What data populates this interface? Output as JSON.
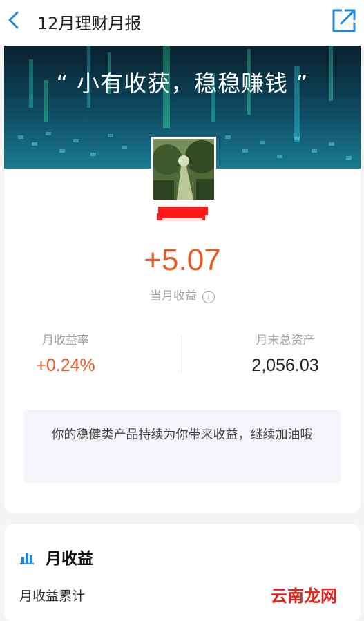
{
  "header": {
    "title": "12月理财月报"
  },
  "banner": {
    "quote": "“ 小有收获，稳稳赚钱 ”"
  },
  "summary": {
    "amount": "+5.07",
    "amount_label": "当月收益",
    "rate_label": "月收益率",
    "rate_value": "+0.24%",
    "assets_label": "月末总资产",
    "assets_value": "2,056.03",
    "tip": "你的稳健类产品持续为你带来收益，继续加油哦"
  },
  "section": {
    "title": "月收益",
    "subtitle": "月收益累计"
  },
  "watermark": {
    "text": "云南龙网"
  },
  "colors": {
    "accent": "#e55a24",
    "brand_blue": "#1e88e5",
    "banner_dark": "#0a2433"
  },
  "icons": {
    "back": "chevron-left-icon",
    "share": "external-link-icon",
    "info": "info-icon",
    "chart": "bar-chart-icon"
  }
}
